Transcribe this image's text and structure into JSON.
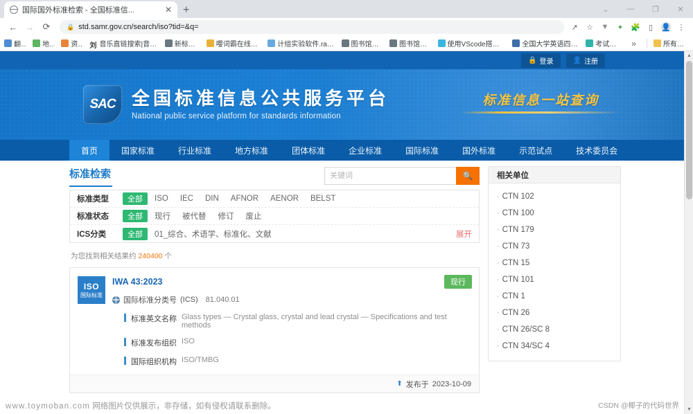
{
  "browser": {
    "tab": {
      "title": "国际国外标准检索 - 全国标准信...",
      "close_label": "✕",
      "new_tab_label": "+"
    },
    "window_controls": {
      "minimize": "—",
      "maximize": "❐",
      "close": "✕",
      "list_tabs": "⌄"
    },
    "nav": {
      "back": "←",
      "forward": "→",
      "reload": "⟳"
    },
    "omnibox": {
      "url": "std.samr.gov.cn/search/iso?tid=&q=",
      "lock_icon": "lock-icon"
    },
    "toolbar_icons": [
      "share-icon",
      "bookmark-star-icon",
      "extension-filter-icon",
      "extension-paint-icon",
      "extensions-puzzle-icon",
      "side-panel-icon",
      "profile-avatar-icon",
      "chrome-menu-icon"
    ],
    "bookmarks": [
      {
        "label": "翻译",
        "color": "#4f8cd6"
      },
      {
        "label": "地图",
        "color": "#5fb563"
      },
      {
        "label": "资讯",
        "color": "#e8833a"
      },
      {
        "label": "音乐直链搜索|音乐...",
        "color": "#ffffff",
        "glyph": "刘"
      },
      {
        "label": "新标签页",
        "color": "#6b7780"
      },
      {
        "label": "嘤词霸在线词典",
        "color": "#e8b23a"
      },
      {
        "label": "计组实验软件.rar_...",
        "color": "#6aa9e0"
      },
      {
        "label": "图书馆首页",
        "color": "#6b7780"
      },
      {
        "label": "图书馆首页",
        "color": "#6b7780"
      },
      {
        "label": "使用VScode搭建R...",
        "color": "#3ab6e0"
      },
      {
        "label": "全国大学英语四、...",
        "color": "#3f6fa8"
      },
      {
        "label": "考试结束",
        "color": "#2fb3a8"
      }
    ],
    "bookmarks_overflow": "»",
    "all_bookmarks": {
      "label": "所有书签",
      "color": "#f2c14e"
    }
  },
  "site": {
    "account": {
      "login": "登录",
      "register": "注册",
      "login_icon": "lock-icon",
      "register_icon": "user-icon"
    },
    "brand": {
      "logo_text": "SAC",
      "title_cn": "全国标准信息公共服务平台",
      "title_en": "National public service platform  for standards information",
      "slogan": "标准信息一站查询"
    },
    "nav_items": [
      {
        "label": "首页",
        "active": true
      },
      {
        "label": "国家标准",
        "active": false
      },
      {
        "label": "行业标准",
        "active": false
      },
      {
        "label": "地方标准",
        "active": false
      },
      {
        "label": "团体标准",
        "active": false
      },
      {
        "label": "企业标准",
        "active": false
      },
      {
        "label": "国际标准",
        "active": false
      },
      {
        "label": "国外标准",
        "active": false
      },
      {
        "label": "示范试点",
        "active": false
      },
      {
        "label": "技术委员会",
        "active": false
      }
    ]
  },
  "search_panel": {
    "title": "标准检索",
    "input_value": "",
    "input_placeholder": "关键词",
    "search_icon": "search-icon",
    "filters": [
      {
        "label": "标准类型",
        "all_label": "全部",
        "options": [
          "ISO",
          "IEC",
          "DIN",
          "AFNOR",
          "AENOR",
          "BELST"
        ],
        "expand": ""
      },
      {
        "label": "标准状态",
        "all_label": "全部",
        "options": [
          "现行",
          "被代替",
          "修订",
          "废止"
        ],
        "expand": ""
      },
      {
        "label": "ICS分类",
        "all_label": "全部",
        "options": [
          "01_综合、术语学、标准化、文献"
        ],
        "expand": "展开"
      }
    ]
  },
  "results": {
    "count_prefix": "为您找到相关结果约",
    "count": "240400",
    "count_suffix": "个",
    "items": [
      {
        "badge_top": "ISO",
        "badge_bottom": "国际标准",
        "title": "IWA 43:2023",
        "status": "现行",
        "ics_label": "国际标准分类号",
        "ics_paren": "(ICS)",
        "ics_value": "81.040.01",
        "meta": [
          {
            "key": "标准英文名称",
            "value": "Glass types — Crystal glass, crystal and lead crystal — Specifications and test methods"
          },
          {
            "key": "标准发布组织",
            "value": "ISO"
          },
          {
            "key": "国际组织机构",
            "value": "ISO/TMBG"
          }
        ],
        "published_icon": "upload-icon",
        "published_label": "发布于",
        "published_date": "2023-10-09"
      }
    ]
  },
  "sidebar": {
    "title": "相关单位",
    "items": [
      {
        "label": "CTN 102"
      },
      {
        "label": "CTN 100"
      },
      {
        "label": "CTN 179"
      },
      {
        "label": "CTN 73"
      },
      {
        "label": "CTN 15"
      },
      {
        "label": "CTN 101"
      },
      {
        "label": "CTN 1"
      },
      {
        "label": "CTN 26"
      },
      {
        "label": "CTN 26/SC 8"
      },
      {
        "label": "CTN 34/SC 4"
      }
    ]
  },
  "watermarks": {
    "left_url": "www.toymoban.com",
    "left_text": "网络图片仅供展示，非存储，如有侵权请联系删除。",
    "right": "CSDN @椰子的代码世界"
  }
}
